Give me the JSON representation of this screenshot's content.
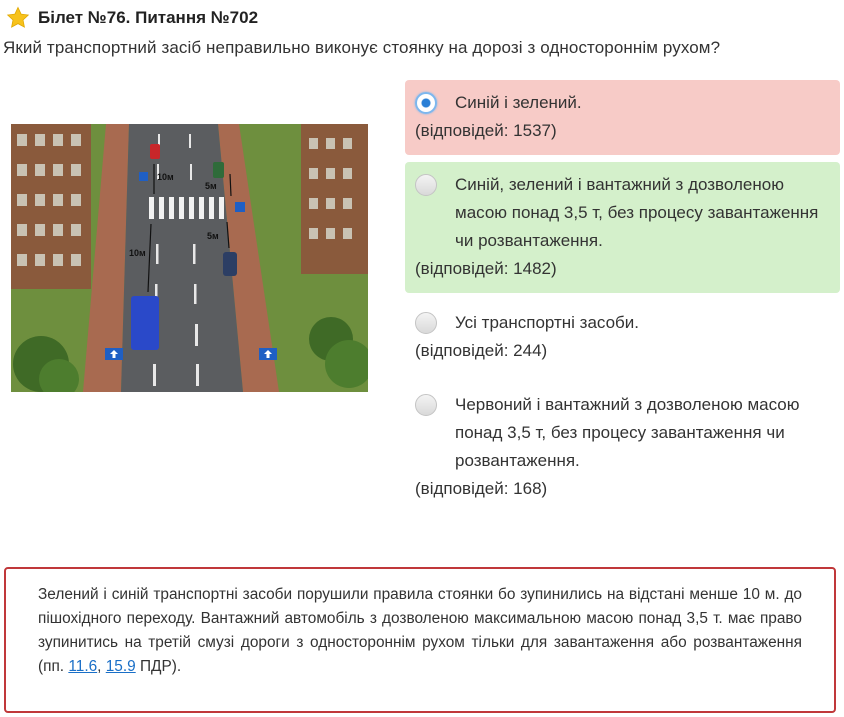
{
  "header": {
    "title": "Білет №76. Питання №702",
    "star_icon": "star-icon",
    "star_color": "#f7c21c"
  },
  "question": "Який транспортний засіб неправильно виконує стоянку на дорозі з одностороннім рухом?",
  "picture": {
    "labels": {
      "dist_top": "10м",
      "dist_right_top": "5м",
      "dist_right": "5м",
      "dist_left": "10м"
    }
  },
  "answers": [
    {
      "text": "Синій і зелений.",
      "count": "(відповідей: 1537)",
      "state": "selected-wrong"
    },
    {
      "text": "Синій, зелений і вантажний з дозволеною масою понад 3,5 т, без процесу завантаження чи розвантаження.",
      "count": "(відповідей: 1482)",
      "state": "correct"
    },
    {
      "text": "Усі транспортні засоби.",
      "count": "(відповідей: 244)",
      "state": "normal"
    },
    {
      "text": "Червоний і вантажний з дозволеною масою понад 3,5 т, без процесу завантаження чи розвантаження.",
      "count": "(відповідей: 168)",
      "state": "normal"
    }
  ],
  "explanation": {
    "text": "Зелений і синій транспортні засоби порушили правила стоянки бо зупинились на відстані менше 10 м. до пішохідного переходу. Вантажний автомобіль з дозволеною максимальною масою понад 3,5 т. має право зупинитись на третій смузі дороги з одностороннім рухом тільки для завантаження або розвантаження (пп.",
    "link1": "11.6",
    "sep": ",",
    "link2": "15.9",
    "tail": "ПДР)."
  },
  "colors": {
    "wrong_bg": "#f7cbc7",
    "correct_bg": "#d4f0cb",
    "explanation_border": "#c0383a",
    "link": "#1a6fc7"
  }
}
